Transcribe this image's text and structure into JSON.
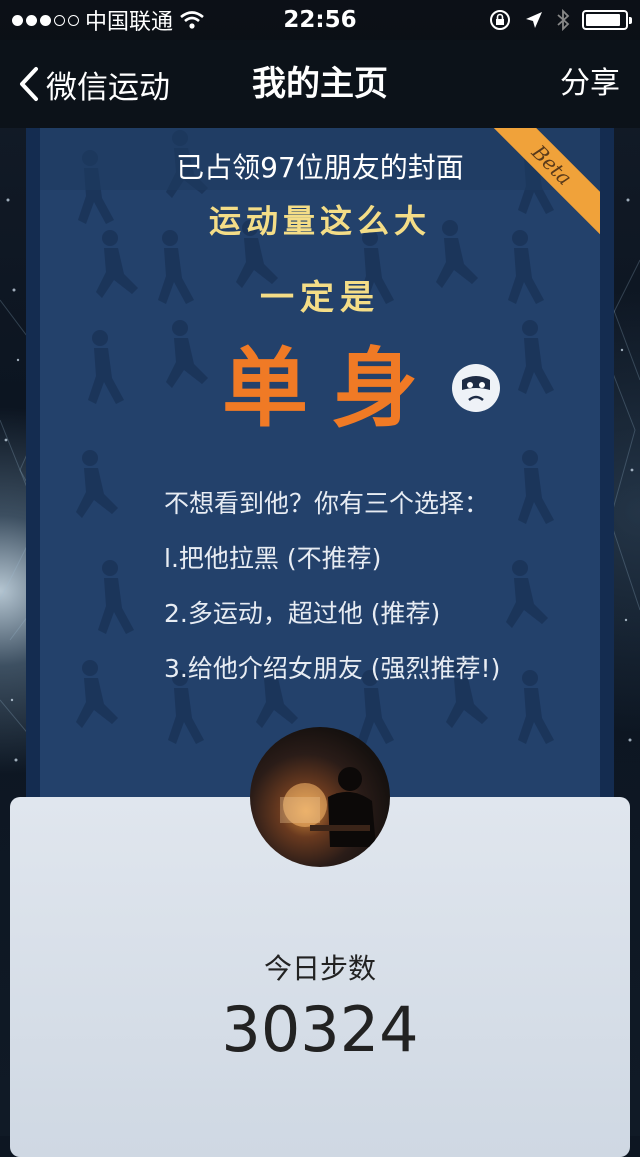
{
  "status_bar": {
    "carrier": "中国联通",
    "time": "22:56",
    "signal_icon": "signal-dots-icon",
    "wifi_icon": "wifi-icon",
    "battery_level": 0.9
  },
  "nav": {
    "back_label": "微信运动",
    "title": "我的主页",
    "share_label": "分享"
  },
  "cover": {
    "line1": "已占领97位朋友的封面",
    "line2": "运动量这么大",
    "line3": "一定是",
    "big_text": "单身",
    "ribbon": "Beta",
    "options": [
      "不想看到他？你有三个选择：",
      "l.把他拉黑 (不推荐)",
      "2.多运动，超过他 (推荐)",
      "3.给他介绍女朋友 (强烈推荐!)"
    ],
    "accent_color": "#f07a25",
    "headline_color": "#f4dd87"
  },
  "stats": {
    "label": "今日步数",
    "value": "30324"
  }
}
